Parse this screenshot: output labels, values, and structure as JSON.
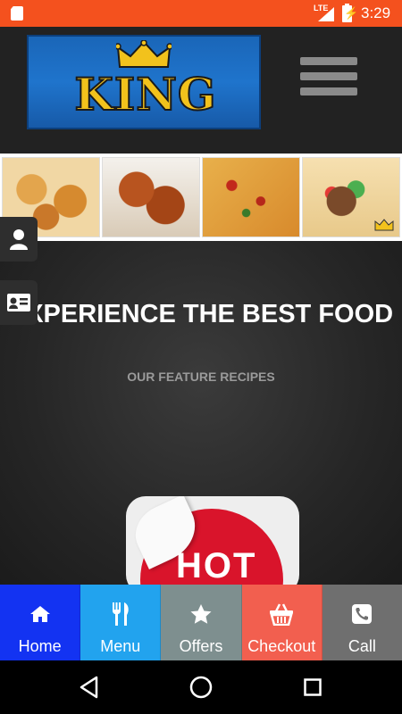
{
  "status_bar": {
    "network": "LTE",
    "time": "3:29",
    "icons": [
      "sd-card-icon",
      "signal-icon",
      "battery-charging-icon"
    ]
  },
  "header": {
    "logo_text": "KING",
    "menu_icon": "hamburger-menu-icon"
  },
  "banner": {
    "images": [
      "onion-rings-image",
      "fried-chicken-image",
      "pizza-image",
      "gyro-wrap-image"
    ]
  },
  "side_buttons": [
    {
      "icon": "user-icon"
    },
    {
      "icon": "contact-card-icon"
    }
  ],
  "hero": {
    "title": "EXPERIENCE THE BEST FOOD",
    "subtitle": "OUR FEATURE RECIPES",
    "feature_badge_text": "HOT"
  },
  "tabs": [
    {
      "label": "Home",
      "icon": "home-icon",
      "color": "#1333f2"
    },
    {
      "label": "Menu",
      "icon": "fork-knife-icon",
      "color": "#22a3ee"
    },
    {
      "label": "Offers",
      "icon": "star-icon",
      "color": "#7e8f8f"
    },
    {
      "label": "Checkout",
      "icon": "basket-icon",
      "color": "#f25f4f"
    },
    {
      "label": "Call",
      "icon": "phone-icon",
      "color": "#6f6f6f"
    }
  ],
  "colors": {
    "status_bar": "#f4511e",
    "header_bg": "#222222",
    "logo_bg": "#1f74cc",
    "logo_text": "#f2c21c"
  }
}
